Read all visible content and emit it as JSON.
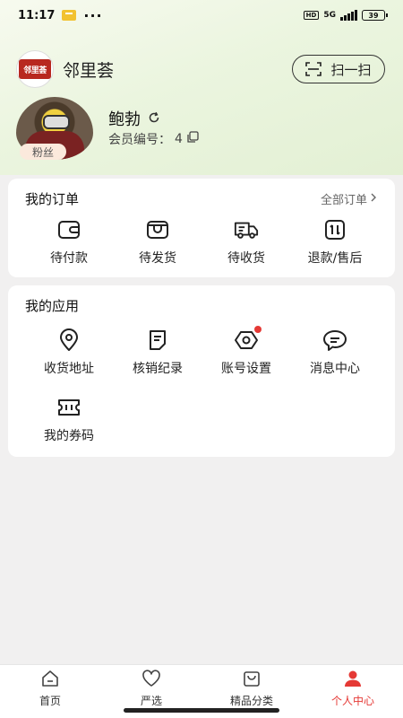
{
  "status_bar": {
    "time": "11:17",
    "more": "···",
    "hd": "HD",
    "network": "5G",
    "battery": "39"
  },
  "header": {
    "brand_logo_text": "邻里荟",
    "brand_name": "邻里荟",
    "scan_label": "扫一扫"
  },
  "profile": {
    "fans_tag": "粉丝",
    "username": "鲍勃",
    "member_label": "会员编号：",
    "member_no": "4"
  },
  "orders": {
    "title": "我的订单",
    "all_label": "全部订单",
    "items": [
      {
        "label": "待付款",
        "icon": "wallet-icon"
      },
      {
        "label": "待发货",
        "icon": "box-icon"
      },
      {
        "label": "待收货",
        "icon": "truck-icon"
      },
      {
        "label": "退款/售后",
        "icon": "refund-icon"
      }
    ]
  },
  "apps": {
    "title": "我的应用",
    "items": [
      {
        "label": "收货地址",
        "icon": "location-icon"
      },
      {
        "label": "核销纪录",
        "icon": "record-icon"
      },
      {
        "label": "账号设置",
        "icon": "settings-icon"
      },
      {
        "label": "消息中心",
        "icon": "message-icon"
      },
      {
        "label": "我的券码",
        "icon": "ticket-icon"
      }
    ]
  },
  "tabs": [
    {
      "label": "首页",
      "icon": "home-icon"
    },
    {
      "label": "严选",
      "icon": "heart-icon"
    },
    {
      "label": "精品分类",
      "icon": "bag-icon"
    },
    {
      "label": "个人中心",
      "icon": "user-icon"
    }
  ],
  "colors": {
    "accent": "#e53935",
    "header_bg": "#e8f3dc"
  }
}
